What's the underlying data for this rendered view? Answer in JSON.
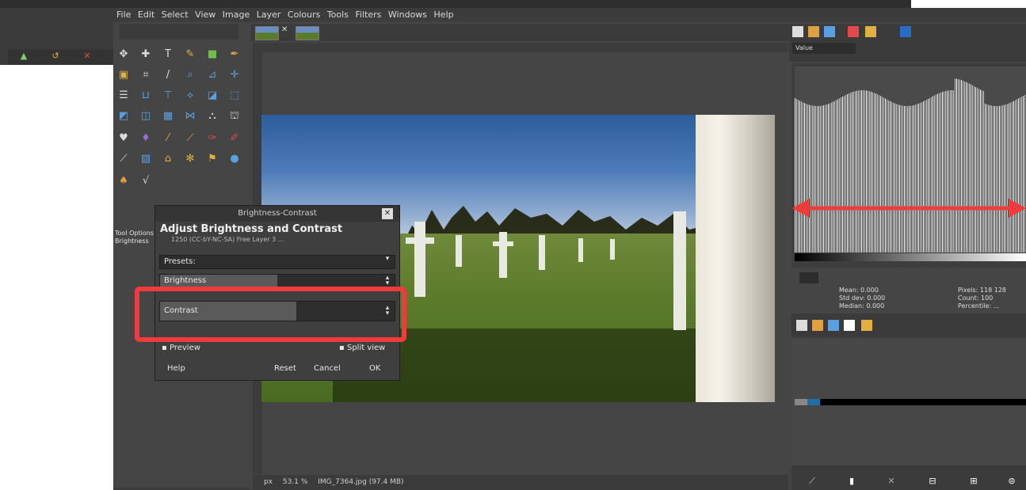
{
  "menu": [
    "File",
    "Edit",
    "Select",
    "View",
    "Image",
    "Layer",
    "Colours",
    "Tools",
    "Filters",
    "Windows",
    "Help"
  ],
  "dialog": {
    "window_title": "Brightness-Contrast",
    "heading": "Adjust Brightness and Contrast",
    "subheading": "1250 (CC-bY-NC-SA) Free Layer 3 ...",
    "presets_label": "Presets:",
    "brightness_label": "Brightness",
    "brightness_value": 0.5,
    "contrast_label": "Contrast",
    "contrast_value": 0.58,
    "preview_label": "Preview",
    "split_view_label": "Split view",
    "help_label": "Help",
    "reset_label": "Reset",
    "cancel_label": "Cancel",
    "ok_label": "OK"
  },
  "tool_options_title": "Tool Options",
  "tool_options_sub": "Brightness",
  "histogram": {
    "channel": "Value",
    "stats_left": [
      "Mean: 0.000",
      "Std dev: 0.000",
      "Median: 0.000"
    ],
    "stats_right": [
      "Pixels: 118 128",
      "Count: 100",
      "Percentile: ..."
    ]
  },
  "status": {
    "unit": "px",
    "zoom": "53.1 %",
    "info": "IMG_7364.jpg (97.4 MB)"
  },
  "colors": {
    "highlight": "#ef3b3b",
    "arrow": "#ef3b3b",
    "dialog_bg": "#3f3f3f"
  },
  "icons": [
    "home-icon",
    "undo-icon",
    "close-icon",
    "reset-icon"
  ]
}
